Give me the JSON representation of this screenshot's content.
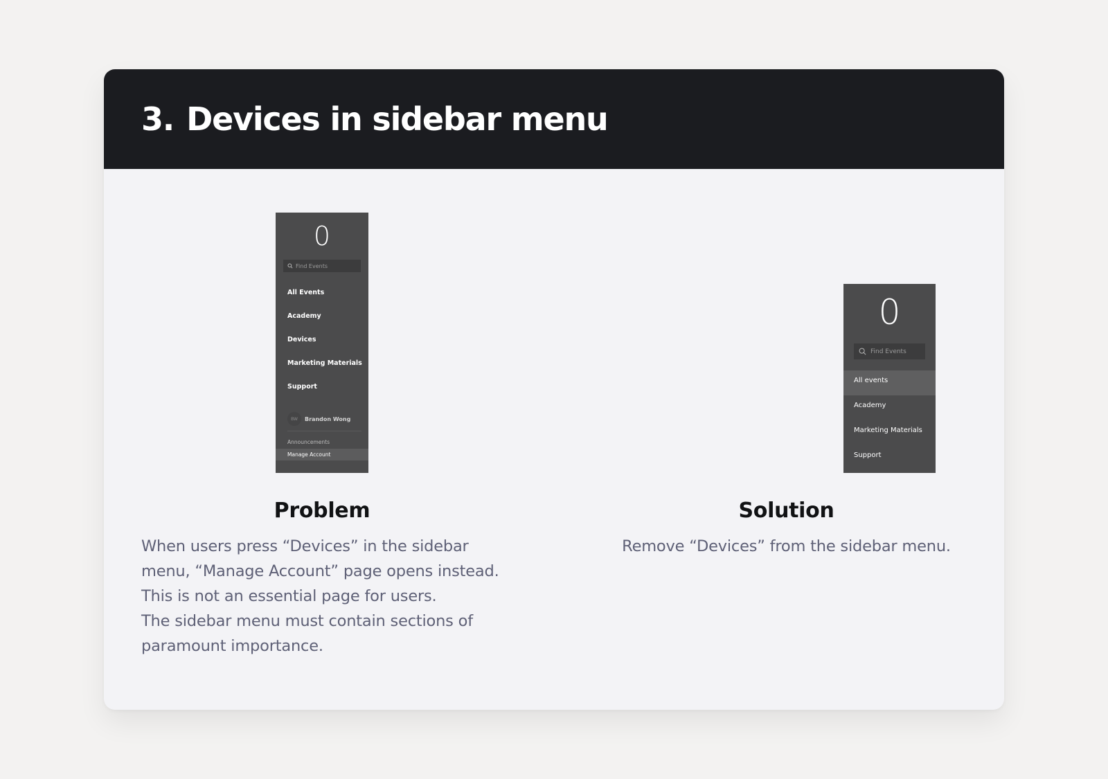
{
  "title": {
    "number": "3.",
    "text": "Devices in sidebar menu"
  },
  "problem": {
    "heading": "Problem",
    "lines": [
      "When users press “Devices” in the sidebar",
      "menu, “Manage Account” page opens instead.",
      "This is not an essential page for users.",
      "The sidebar menu must contain sections of",
      "paramount importance."
    ],
    "mockup": {
      "logo": "0",
      "search_placeholder": "Find Events",
      "menu": [
        "All Events",
        "Academy",
        "Devices",
        "Marketing Materials",
        "Support"
      ],
      "avatar_initials": "BW",
      "user_name": "Brandon Wong",
      "submenu": [
        "Announcements",
        "Manage Account"
      ]
    }
  },
  "solution": {
    "heading": "Solution",
    "lines": [
      "Remove “Devices” from the sidebar menu."
    ],
    "mockup": {
      "logo": "0",
      "search_placeholder": "Find Events",
      "menu": [
        "All events",
        "Academy",
        "Marketing Materials",
        "Support"
      ]
    }
  },
  "colors": {
    "page_background": "#f3f2f1",
    "card_background": "#f3f3f6",
    "header_background": "#1b1c20",
    "sidebar_background": "#4b4b4c",
    "body_text": "#5e6076"
  }
}
